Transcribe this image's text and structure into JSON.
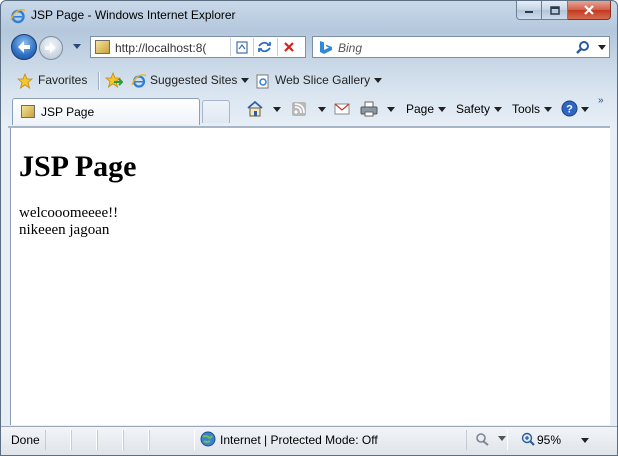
{
  "window": {
    "title": "JSP Page - Windows Internet Explorer"
  },
  "nav": {
    "address": "http://localhost:8(",
    "search_placeholder": "Bing"
  },
  "favorites_bar": {
    "favorites_label": "Favorites",
    "suggested_sites_label": "Suggested Sites",
    "web_slice_label": "Web Slice Gallery"
  },
  "tabs": [
    {
      "title": "JSP Page"
    }
  ],
  "command_bar": {
    "page_label": "Page",
    "safety_label": "Safety",
    "tools_label": "Tools"
  },
  "page": {
    "heading": "JSP Page",
    "lines": [
      "welcooomeeee!!",
      "nikeeen jagoan"
    ]
  },
  "status_bar": {
    "status": "Done",
    "zone": "Internet | Protected Mode: Off",
    "zoom": "95%"
  },
  "colors": {
    "accent": "#2d6fc4",
    "close_button": "#c2391f"
  }
}
